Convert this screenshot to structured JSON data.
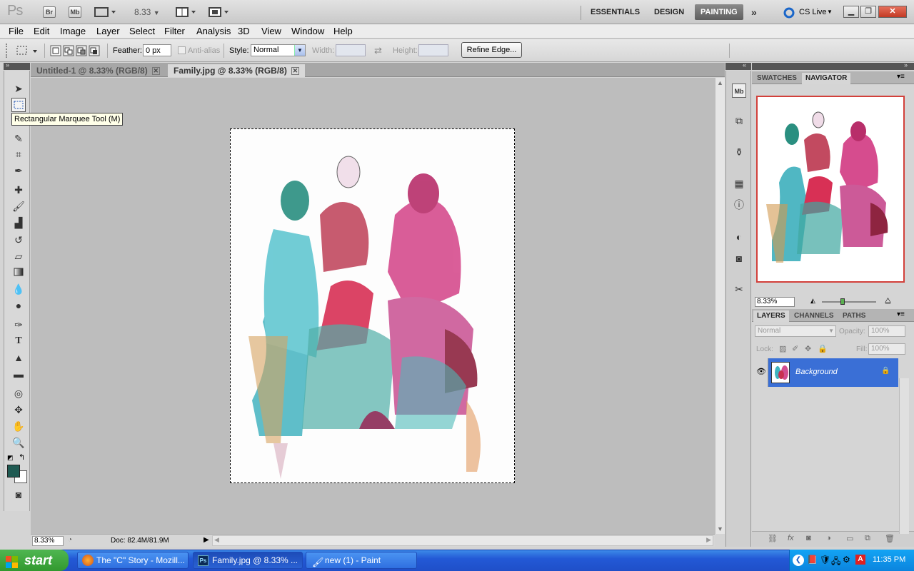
{
  "appbar": {
    "logo": "Ps",
    "bridge_label": "Br",
    "minibridge_label": "Mb",
    "zoom_level": "8.33",
    "workspaces": [
      "ESSENTIALS",
      "DESIGN",
      "PAINTING"
    ],
    "active_workspace": "PAINTING",
    "cs_live": "CS Live"
  },
  "menu": [
    "File",
    "Edit",
    "Image",
    "Layer",
    "Select",
    "Filter",
    "Analysis",
    "3D",
    "View",
    "Window",
    "Help"
  ],
  "options": {
    "feather_label": "Feather:",
    "feather_value": "0 px",
    "antialias_label": "Anti-alias",
    "style_label": "Style:",
    "style_value": "Normal",
    "width_label": "Width:",
    "height_label": "Height:",
    "refine_edge": "Refine Edge..."
  },
  "tabs": [
    {
      "label": "Untitled-1 @ 8.33% (RGB/8)",
      "active": false
    },
    {
      "label": "Family.jpg @ 8.33% (RGB/8)",
      "active": true
    }
  ],
  "tooltip": "Rectangular Marquee Tool (M)",
  "status": {
    "zoom": "8.33%",
    "doc": "Doc: 82.4M/81.9M"
  },
  "panels": {
    "top_tabs": [
      "SWATCHES",
      "NAVIGATOR"
    ],
    "top_active": "NAVIGATOR",
    "nav_zoom": "8.33%",
    "layer_tabs": [
      "LAYERS",
      "CHANNELS",
      "PATHS"
    ],
    "layer_active": "LAYERS",
    "blend_mode": "Normal",
    "opacity_label": "Opacity:",
    "opacity_value": "100%",
    "lock_label": "Lock:",
    "fill_label": "Fill:",
    "fill_value": "100%",
    "layer_name": "Background"
  },
  "colors": {
    "foreground": "#1f5a52",
    "background": "#ffffff",
    "layer_selected": "#3a6fd6",
    "nav_box": "#d2403a"
  },
  "taskbar": {
    "start": "start",
    "tasks": [
      {
        "label": "The \"C\" Story - Mozill...",
        "icon": "firefox-icon"
      },
      {
        "label": "Family.jpg @ 8.33% ...",
        "icon": "photoshop-icon"
      },
      {
        "label": "new (1) - Paint",
        "icon": "paint-icon"
      }
    ],
    "clock": "11:35 PM"
  }
}
